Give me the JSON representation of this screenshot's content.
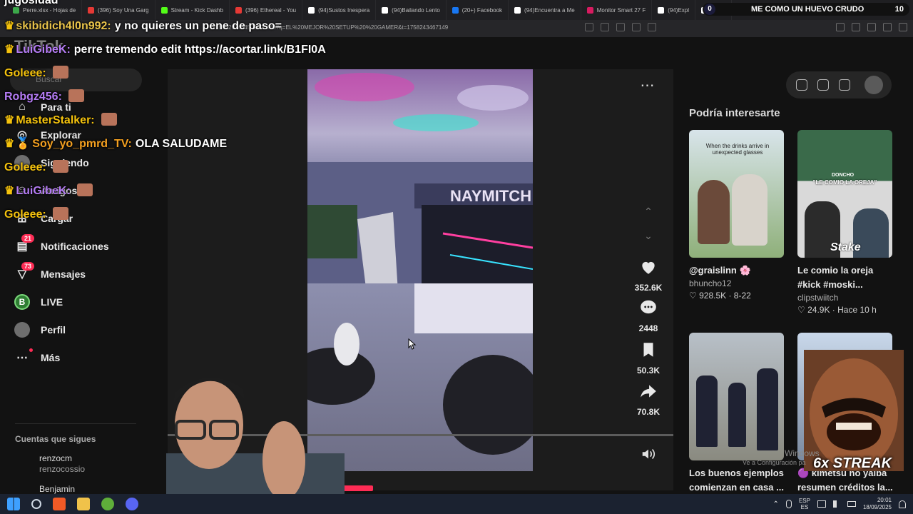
{
  "browser": {
    "tabs": [
      {
        "label": "Perre.xlsx - Hojas de",
        "color": "#3ca84a"
      },
      {
        "label": "(396) Soy Una Garg",
        "color": "#e53935"
      },
      {
        "label": "Stream - Kick Dashb",
        "color": "#53fc18"
      },
      {
        "label": "(396) Ethereal - You",
        "color": "#e53935"
      },
      {
        "label": "(94)Sustos Inespera",
        "color": "#ffffff"
      },
      {
        "label": "(94)Bailando Lento",
        "color": "#ffffff"
      },
      {
        "label": "(20+) Facebook",
        "color": "#1877f2"
      },
      {
        "label": "(94)Encuentra a Me",
        "color": "#ffffff"
      },
      {
        "label": "Monitor Smart 27 F",
        "color": "#d81b60"
      },
      {
        "label": "(94)Expl",
        "color": "#ffffff"
      },
      {
        "label": "Mega",
        "color": "#ffffff"
      }
    ],
    "url": "...5002974845021258467q=EL%20MEJOR%20SETUP%20%20GAMER&t=1758243467149"
  },
  "top_pill": {
    "left_count": "0",
    "title": "ME COMO UN HUEVO CRUDO",
    "right_count": "10"
  },
  "sidebar": {
    "logo": "TikTok",
    "search_placeholder": "Buscar",
    "items": [
      {
        "label": "Para ti",
        "icon": "home-icon"
      },
      {
        "label": "Explorar",
        "icon": "compass-icon"
      },
      {
        "label": "Siguiendo",
        "icon": "following-icon"
      },
      {
        "label": "Amigos",
        "icon": "friends-icon"
      },
      {
        "label": "Cargar",
        "icon": "upload-icon"
      },
      {
        "label": "Notificaciones",
        "icon": "inbox-icon",
        "badge": "21"
      },
      {
        "label": "Mensajes",
        "icon": "messages-icon",
        "badge": "73"
      },
      {
        "label": "LIVE",
        "icon": "live-icon"
      },
      {
        "label": "Perfil",
        "icon": "profile-icon"
      },
      {
        "label": "Más",
        "icon": "more-icon"
      }
    ],
    "following_title": "Cuentas que sigues",
    "following": [
      {
        "name": "renzocm",
        "handle": "renzocossio"
      },
      {
        "name": "Benjamin",
        "handle": ""
      }
    ]
  },
  "player": {
    "actions": [
      {
        "icon": "heart-icon",
        "count": "352.6K"
      },
      {
        "icon": "comment-icon",
        "count": "2448"
      },
      {
        "icon": "bookmark-icon",
        "count": "50.3K"
      },
      {
        "icon": "share-icon",
        "count": "70.8K"
      }
    ],
    "video_text": "NAYMITCH"
  },
  "suggestions": {
    "title": "Podría interesarte",
    "cards": [
      {
        "caption": "@graislinn 🌸",
        "author": "bhuncho12",
        "meta": "♡ 928.5K · 8-22",
        "thumb_text": "When the drinks arrive in unexpected glasses"
      },
      {
        "caption": "Le comio la oreja",
        "caption2": "#kick #moski...",
        "author": "clipstwiitch",
        "meta": "♡ 24.9K · Hace 10 h",
        "thumb_text": "\"LE COMIO LA OREJA\"",
        "thumb_text2": "DONCHO",
        "brand": "Stake"
      },
      {
        "caption": "Los buenos ejemplos",
        "caption2": "comienzan en casa ..."
      },
      {
        "caption": "🟣 kimetsu no yaiba",
        "caption2": "resumen créditos la..."
      }
    ]
  },
  "chat": [
    {
      "user": "",
      "msg": "jugosidad",
      "color": "#ffffff",
      "crown": false
    },
    {
      "user": "skibidich4l0n992:",
      "msg": "y no quieres un pene de paso=",
      "color": "#e8c34a",
      "crown": true
    },
    {
      "user": "LuiGibeK:",
      "msg": "perre tremendo edit https://acortar.link/B1FI0A",
      "color": "#b57cf5",
      "crown": true
    },
    {
      "user": "Goleee:",
      "msg": "",
      "color": "#f4c20d",
      "crown": false,
      "emote": true
    },
    {
      "user": "Robgz456:",
      "msg": "",
      "color": "#b57cf5",
      "crown": false,
      "emote": true
    },
    {
      "user": "MasterStalker:",
      "msg": "",
      "color": "#f4c20d",
      "crown": true,
      "emote": true
    },
    {
      "user": "Soy_yo_pmrd_TV:",
      "msg": "OLA SALUDAME",
      "color": "#f4a020",
      "crown": true,
      "badge": "🏅"
    },
    {
      "user": "Goleee:",
      "msg": "",
      "color": "#f4c20d",
      "crown": false,
      "emote": true
    },
    {
      "user": "LuiGibeK:",
      "msg": "",
      "color": "#b57cf5",
      "crown": true,
      "emote": true
    },
    {
      "user": "Goleee:",
      "msg": "",
      "color": "#f4c20d",
      "crown": false,
      "emote": true
    }
  ],
  "overlay": {
    "streak": "6x STREAK",
    "windows_watermark": "Windows",
    "windows_sub": "Ve a Configuración pa"
  },
  "taskbar": {
    "lang1": "ESP",
    "lang2": "ES",
    "time": "20:01",
    "date": "18/09/2025"
  }
}
